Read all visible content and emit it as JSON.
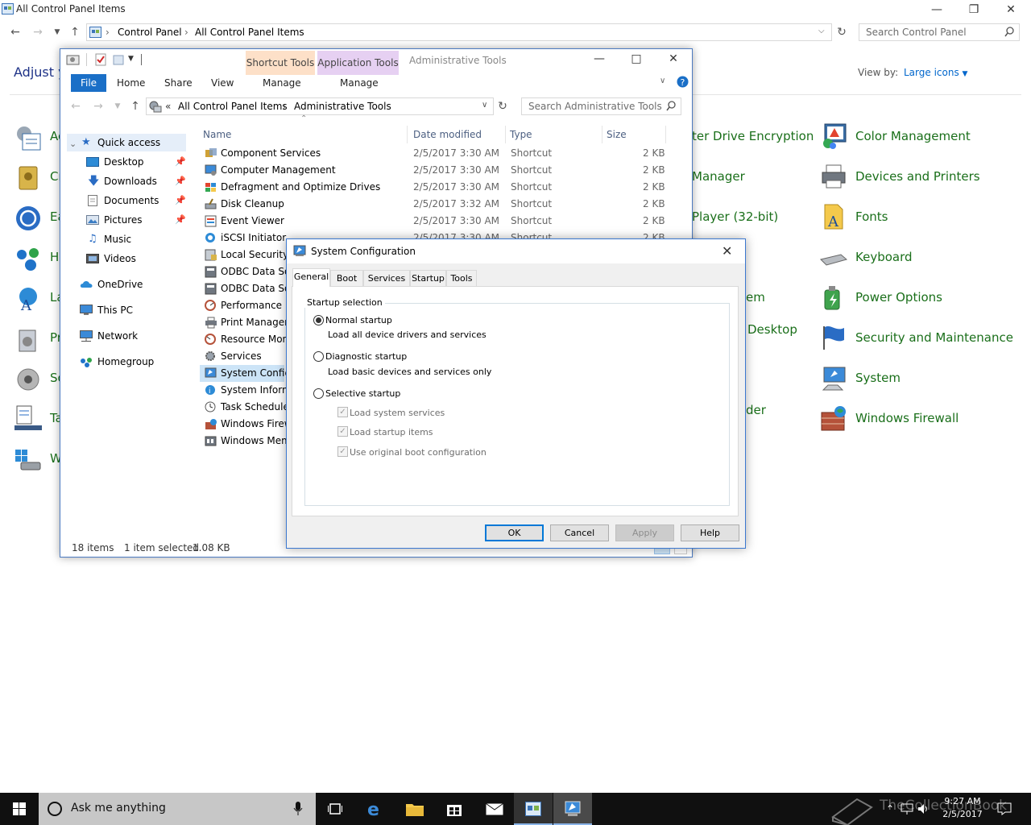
{
  "control_panel": {
    "title": "All Control Panel Items",
    "breadcrumb": [
      "Control Panel",
      "All Control Panel Items"
    ],
    "search_placeholder": "Search Control Panel",
    "heading": "Adjust y",
    "view_by_label": "View by:",
    "view_by_value": "Large icons",
    "left_items": [
      "Ac",
      "Cr",
      "Ea",
      "Ho",
      "La",
      "Pr",
      "So",
      "Ta",
      "W"
    ],
    "middle_items": [
      "ter Drive Encryption",
      "Manager",
      "Player (32-bit)",
      "em",
      "Desktop",
      "der"
    ],
    "right_items": [
      "Color Management",
      "Devices and Printers",
      "Fonts",
      "Keyboard",
      "Power Options",
      "Security and Maintenance",
      "System",
      "Windows Firewall"
    ]
  },
  "explorer": {
    "title": "Administrative Tools",
    "ribbon": {
      "file": "File",
      "home": "Home",
      "share": "Share",
      "view": "View",
      "shortcut_tools": "Shortcut Tools",
      "application_tools": "Application Tools",
      "manage1": "Manage",
      "manage2": "Manage"
    },
    "address": [
      "«",
      "All Control Panel Items",
      "Administrative Tools"
    ],
    "search_placeholder": "Search Administrative Tools",
    "nav": {
      "quick_access": "Quick access",
      "desktop": "Desktop",
      "downloads": "Downloads",
      "documents": "Documents",
      "pictures": "Pictures",
      "music": "Music",
      "videos": "Videos",
      "onedrive": "OneDrive",
      "this_pc": "This PC",
      "network": "Network",
      "homegroup": "Homegroup"
    },
    "columns": {
      "name": "Name",
      "date": "Date modified",
      "type": "Type",
      "size": "Size"
    },
    "files": [
      {
        "name": "Component Services",
        "date": "2/5/2017 3:30 AM",
        "type": "Shortcut",
        "size": "2 KB"
      },
      {
        "name": "Computer Management",
        "date": "2/5/2017 3:30 AM",
        "type": "Shortcut",
        "size": "2 KB"
      },
      {
        "name": "Defragment and Optimize Drives",
        "date": "2/5/2017 3:30 AM",
        "type": "Shortcut",
        "size": "2 KB"
      },
      {
        "name": "Disk Cleanup",
        "date": "2/5/2017 3:32 AM",
        "type": "Shortcut",
        "size": "2 KB"
      },
      {
        "name": "Event Viewer",
        "date": "2/5/2017 3:30 AM",
        "type": "Shortcut",
        "size": "2 KB"
      },
      {
        "name": "iSCSI Initiator",
        "date": "2/5/2017 3:30 AM",
        "type": "Shortcut",
        "size": "2 KB"
      },
      {
        "name": "Local Security P",
        "date": "",
        "type": "",
        "size": ""
      },
      {
        "name": "ODBC Data Sou",
        "date": "",
        "type": "",
        "size": ""
      },
      {
        "name": "ODBC Data Sou",
        "date": "",
        "type": "",
        "size": ""
      },
      {
        "name": "Performance M",
        "date": "",
        "type": "",
        "size": ""
      },
      {
        "name": "Print Managem",
        "date": "",
        "type": "",
        "size": ""
      },
      {
        "name": "Resource Monit",
        "date": "",
        "type": "",
        "size": ""
      },
      {
        "name": "Services",
        "date": "",
        "type": "",
        "size": ""
      },
      {
        "name": "System Configu",
        "date": "",
        "type": "",
        "size": ""
      },
      {
        "name": "System Informa",
        "date": "",
        "type": "",
        "size": ""
      },
      {
        "name": "Task Scheduler",
        "date": "",
        "type": "",
        "size": ""
      },
      {
        "name": "Windows Firewa",
        "date": "",
        "type": "",
        "size": ""
      },
      {
        "name": "Windows Memo",
        "date": "",
        "type": "",
        "size": ""
      }
    ],
    "status": {
      "count": "18 items",
      "selected": "1 item selected",
      "size": "1.08 KB"
    }
  },
  "msconfig": {
    "title": "System Configuration",
    "tabs": [
      "General",
      "Boot",
      "Services",
      "Startup",
      "Tools"
    ],
    "group_label": "Startup selection",
    "normal": "Normal startup",
    "normal_desc": "Load all device drivers and services",
    "diagnostic": "Diagnostic startup",
    "diagnostic_desc": "Load basic devices and services only",
    "selective": "Selective startup",
    "chk_services": "Load system services",
    "chk_startup": "Load startup items",
    "chk_boot": "Use original boot configuration",
    "buttons": {
      "ok": "OK",
      "cancel": "Cancel",
      "apply": "Apply",
      "help": "Help"
    }
  },
  "taskbar": {
    "search_text": "Ask me anything",
    "watermark": "TheCollectionBook",
    "time": "9:27 AM",
    "date": "2/5/2017"
  },
  "colors": {
    "accent": "#0078d7",
    "cp_link": "#1a6f1a",
    "shortcut_tools": "#fde0c8",
    "application_tools": "#e6d0f2",
    "taskbar": "#101010"
  }
}
